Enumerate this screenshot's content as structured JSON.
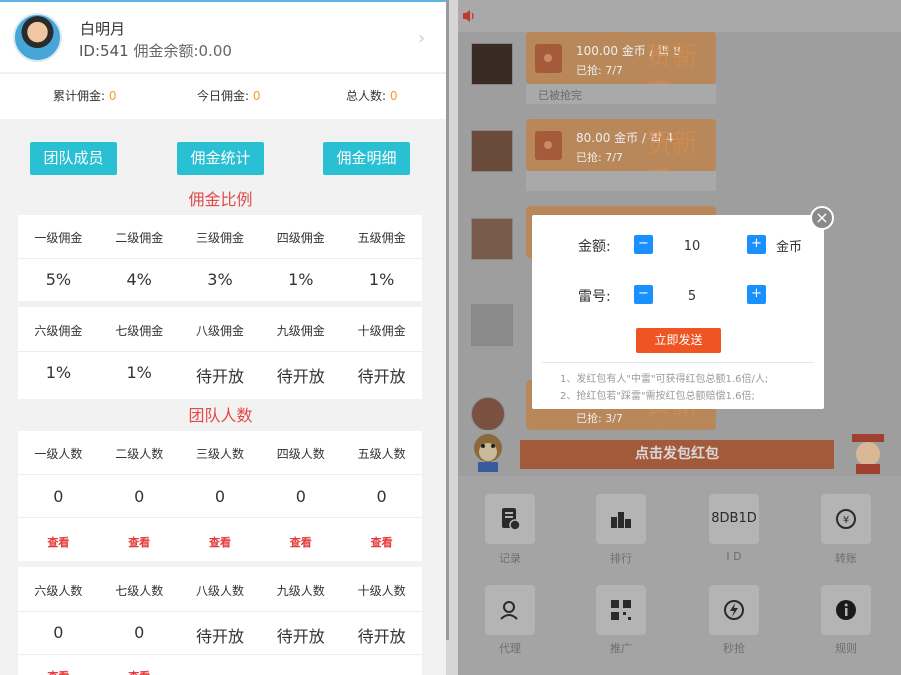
{
  "profile": {
    "name": "白明月",
    "id_label": "ID:541",
    "balance_label": "佣金余额:0.00"
  },
  "stats": [
    {
      "label": "累计佣金:",
      "value": "0"
    },
    {
      "label": "今日佣金:",
      "value": "0"
    },
    {
      "label": "总人数:",
      "value": "0"
    }
  ],
  "buttons": {
    "team_members": "团队成员",
    "commission_stats": "佣金统计",
    "commission_detail": "佣金明细"
  },
  "commission_section": {
    "title": "佣金比例",
    "row1_headers": [
      "一级佣金",
      "二级佣金",
      "三级佣金",
      "四级佣金",
      "五级佣金"
    ],
    "row1_values": [
      "5%",
      "4%",
      "3%",
      "1%",
      "1%"
    ],
    "row2_headers": [
      "六级佣金",
      "七级佣金",
      "八级佣金",
      "九级佣金",
      "十级佣金"
    ],
    "row2_values": [
      "1%",
      "1%",
      "待开放",
      "待开放",
      "待开放"
    ]
  },
  "team_section": {
    "title": "团队人数",
    "row1_headers": [
      "一级人数",
      "二级人数",
      "三级人数",
      "四级人数",
      "五级人数"
    ],
    "row1_values": [
      "0",
      "0",
      "0",
      "0",
      "0"
    ],
    "view_label": "查看",
    "row2_headers": [
      "六级人数",
      "七级人数",
      "八级人数",
      "九级人数",
      "十级人数"
    ],
    "row2_values": [
      "0",
      "0",
      "待开放",
      "待开放",
      "待开放"
    ]
  },
  "red_packets": [
    {
      "amount": "100.00 金币 / 雷 8",
      "grabbed": "已抢: 7/7",
      "status": "已被抢完"
    },
    {
      "amount": "80.00 金币 / 雷 4",
      "grabbed": "已抢: 7/7",
      "status": "已被抢完"
    },
    {
      "grabbed": "已抢: 3/7"
    }
  ],
  "send_packet_button": "点击发包红包",
  "bottom_grid": [
    {
      "label": "记录",
      "icon": "record-icon"
    },
    {
      "label": "排行",
      "icon": "ranking-icon"
    },
    {
      "label": "I D",
      "icon": "id-icon",
      "tile_text": "8DB1D"
    },
    {
      "label": "转账",
      "icon": "transfer-icon"
    },
    {
      "label": "代理",
      "icon": "agent-icon"
    },
    {
      "label": "推广",
      "icon": "qrcode-icon"
    },
    {
      "label": "秒抢",
      "icon": "lightning-icon"
    },
    {
      "label": "规则",
      "icon": "info-icon"
    }
  ],
  "modal": {
    "amount_label": "金额:",
    "amount_value": "10",
    "amount_unit": "金币",
    "mine_label": "雷号:",
    "mine_value": "5",
    "send_label": "立即发送",
    "notes": [
      "1、发红包有人\"中雷\"可获得红包总额1.6倍/人;",
      "2、抢红包若\"踩雷\"需按红包总额赔偿1.6倍;"
    ]
  },
  "colors": {
    "accent_cyan": "#2ac0d4",
    "section_red": "#e24a4a",
    "pending_purple": "#8e8edb",
    "stat_orange": "#f0a020",
    "modal_blue": "#1a90ff",
    "send_orange": "#ee5522"
  }
}
